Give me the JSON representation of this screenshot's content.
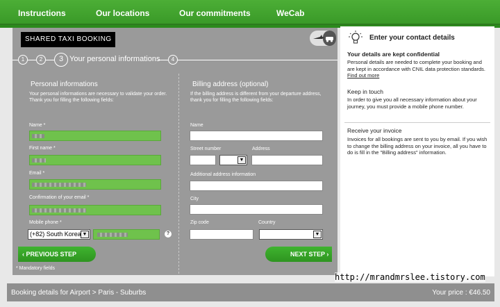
{
  "nav": {
    "items": [
      "Instructions",
      "Our locations",
      "Our commitments",
      "WeCab"
    ]
  },
  "header": {
    "badge": "SHARED TAXI BOOKING",
    "taxi_icon": "taxi-plane-icon"
  },
  "steps": {
    "items": [
      "1",
      "2",
      "3",
      "4"
    ],
    "active_label": "Your personal informations"
  },
  "personal": {
    "title": "Personal informations",
    "note": "Your personal informations are necessary to validate your order. Thank you for filling the following fields:",
    "name_label": "Name",
    "firstname_label": "First name",
    "email_label": "Email",
    "confirm_email_label": "Confirmation of your email",
    "mobile_label": "Mobile phone",
    "country_code": "(+82) South Korea",
    "required_mark": "*"
  },
  "billing": {
    "title": "Billing address (optional)",
    "note": "If the billing address is different from your departure address, thank you for filling the following fields:",
    "name_label": "Name",
    "street_number_label": "Street number",
    "address_label": "Address",
    "additional_label": "Additional address information",
    "city_label": "City",
    "zip_label": "Zip code",
    "country_label": "Country"
  },
  "buttons": {
    "previous": "PREVIOUS STEP",
    "next": "NEXT STEP"
  },
  "mandatory": "* Mandatory fields",
  "sidebar": {
    "title": "Enter your contact details",
    "sections": [
      {
        "heading": "Your details are kept confidential",
        "text": "Personal details are needed to complete your booking and are kept in accordance with CNIL data protection standards.",
        "link": "Find out more"
      },
      {
        "heading": "Keep in touch",
        "text": "In order to give you all necessary information about your journey, you must provide a mobile phone number."
      },
      {
        "heading": "Receive your invoice",
        "text": "Invoices for all bookings are sent to you by email. If you wish to change the billing address on your invoice, all you have to do is fill in the \"Billing address\" information."
      }
    ]
  },
  "bottom": {
    "booking": "Booking details for Airport > Paris - Suburbs",
    "price": "Your price : €46.50"
  },
  "watermark": "http://mrandmrslee.tistory.com",
  "colors": {
    "nav_green": "#3a9a28",
    "field_green": "#6fc24c",
    "panel_grey": "#9a9a9a"
  }
}
